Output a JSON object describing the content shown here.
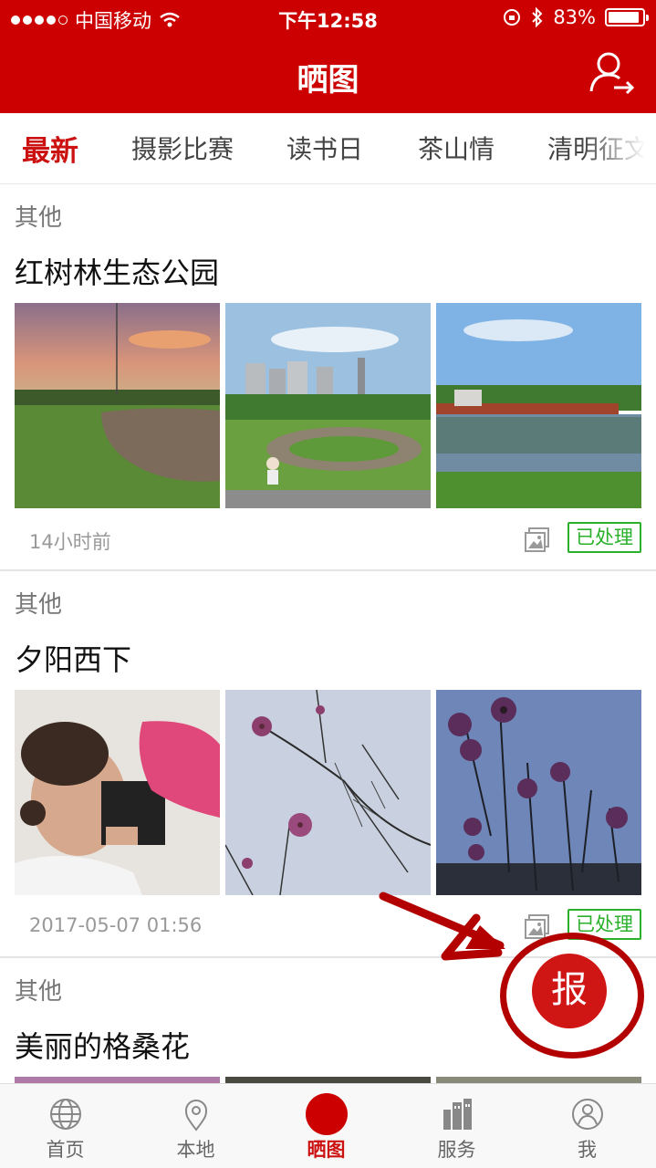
{
  "status_bar": {
    "carrier": "中国移动",
    "time": "下午12:58",
    "battery": "83%",
    "battery_level": 0.83,
    "signal_bars": 4
  },
  "header": {
    "title": "晒图",
    "login_icon": "user-arrow-icon"
  },
  "tabs": [
    {
      "label": "最新",
      "active": true
    },
    {
      "label": "摄影比赛",
      "active": false
    },
    {
      "label": "读书日",
      "active": false
    },
    {
      "label": "茶山情",
      "active": false
    },
    {
      "label": "清明征文",
      "active": false
    }
  ],
  "posts": [
    {
      "category": "其他",
      "title": "红树林生态公园",
      "time": "14小时前",
      "status": "已处理",
      "gallery_icon": "gallery-icon"
    },
    {
      "category": "其他",
      "title": "夕阳西下",
      "time": "2017-05-07 01:56",
      "status": "已处理",
      "gallery_icon": "gallery-icon"
    },
    {
      "category": "其他",
      "title": "美丽的格桑花"
    }
  ],
  "fab": {
    "label": "报"
  },
  "tabbar": [
    {
      "label": "首页",
      "icon": "globe-icon",
      "active": false
    },
    {
      "label": "本地",
      "icon": "location-pin-icon",
      "active": false
    },
    {
      "label": "晒图",
      "icon": "red-dot-icon",
      "active": true
    },
    {
      "label": "服务",
      "icon": "buildings-icon",
      "active": false
    },
    {
      "label": "我",
      "icon": "person-icon",
      "active": false
    }
  ],
  "colors": {
    "brand_red": "#cc0000",
    "active_tab": "#cc1111",
    "status_green": "#2ab02a"
  }
}
